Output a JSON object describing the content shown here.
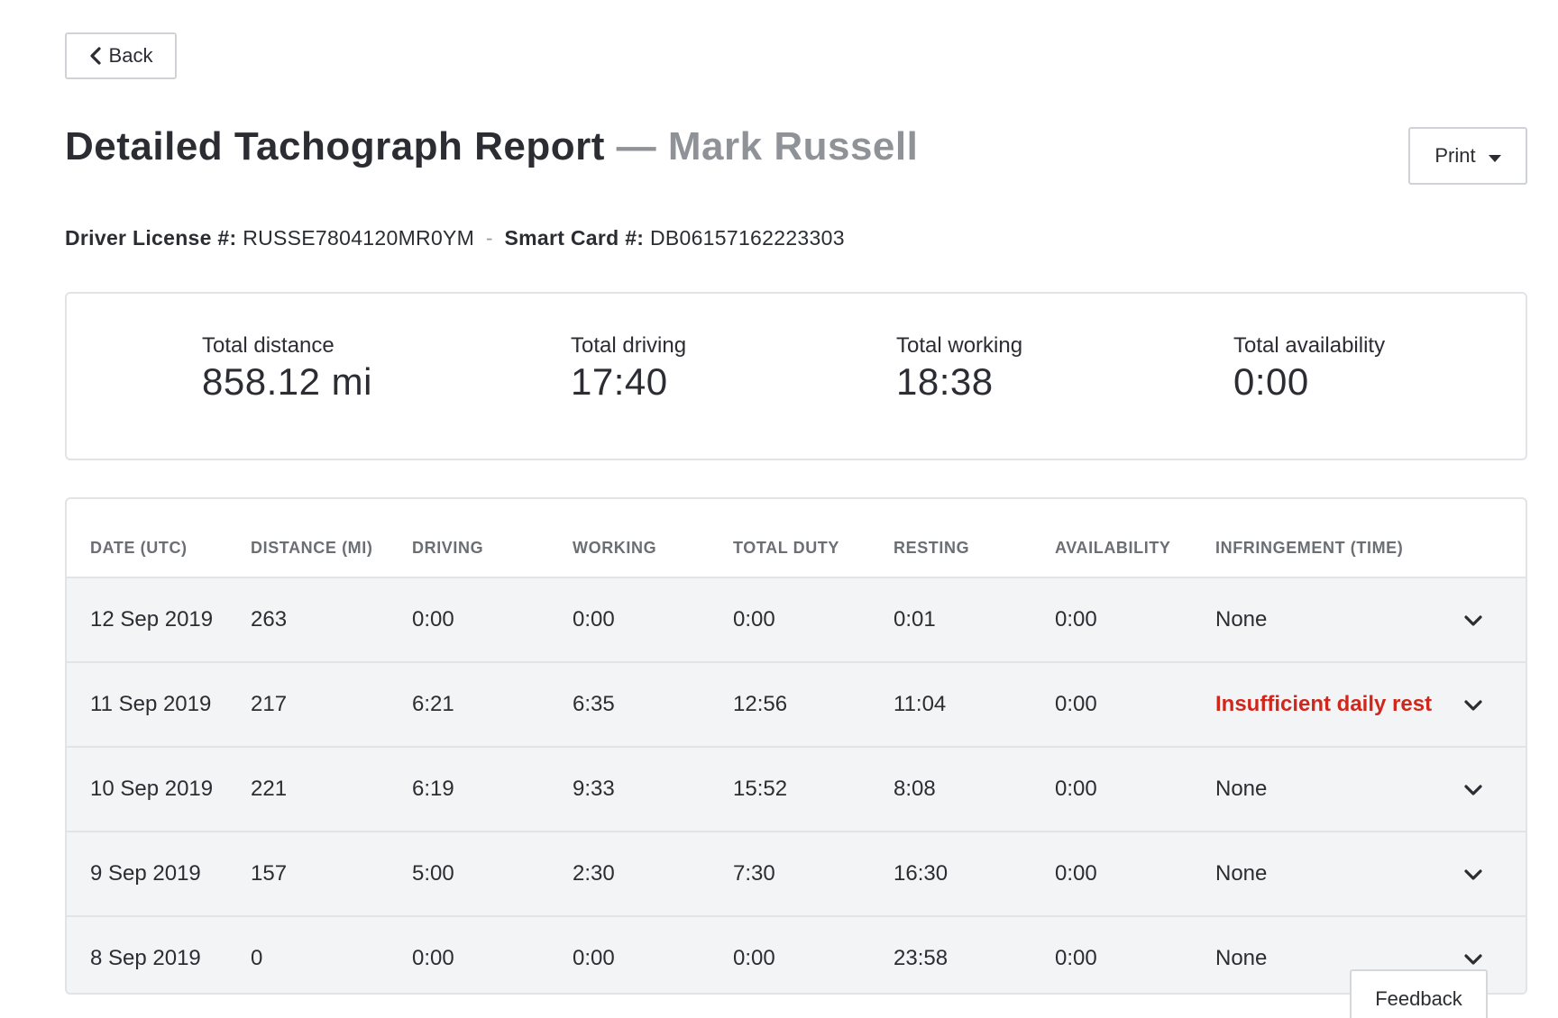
{
  "header": {
    "back_label": "Back",
    "title": "Detailed Tachograph Report",
    "subtitle": "— Mark Russell",
    "print_label": "Print"
  },
  "driver": {
    "license_label": "Driver License #:",
    "license_value": "RUSSE7804120MR0YM",
    "separator": "-",
    "card_label": "Smart Card #:",
    "card_value": "DB06157162223303"
  },
  "summary": [
    {
      "label": "Total distance",
      "value": "858.12 mi"
    },
    {
      "label": "Total driving",
      "value": "17:40"
    },
    {
      "label": "Total working",
      "value": "18:38"
    },
    {
      "label": "Total availability",
      "value": "0:00"
    }
  ],
  "table": {
    "columns": [
      "DATE (UTC)",
      "DISTANCE (MI)",
      "DRIVING",
      "WORKING",
      "TOTAL DUTY",
      "RESTING",
      "AVAILABILITY",
      "INFRINGEMENT (TIME)"
    ],
    "rows": [
      {
        "date": "12 Sep 2019",
        "distance": "263",
        "driving": "0:00",
        "working": "0:00",
        "total_duty": "0:00",
        "resting": "0:01",
        "availability": "0:00",
        "infringement": "None"
      },
      {
        "date": "11 Sep 2019",
        "distance": "217",
        "driving": "6:21",
        "working": "6:35",
        "total_duty": "12:56",
        "resting": "11:04",
        "availability": "0:00",
        "infringement": "Insufficient daily rest"
      },
      {
        "date": "10 Sep 2019",
        "distance": "221",
        "driving": "6:19",
        "working": "9:33",
        "total_duty": "15:52",
        "resting": "8:08",
        "availability": "0:00",
        "infringement": "None"
      },
      {
        "date": "9 Sep 2019",
        "distance": "157",
        "driving": "5:00",
        "working": "2:30",
        "total_duty": "7:30",
        "resting": "16:30",
        "availability": "0:00",
        "infringement": "None"
      },
      {
        "date": "8 Sep 2019",
        "distance": "0",
        "driving": "0:00",
        "working": "0:00",
        "total_duty": "0:00",
        "resting": "23:58",
        "availability": "0:00",
        "infringement": "None"
      }
    ]
  },
  "feedback_label": "Feedback",
  "colors": {
    "alert": "#d0271d",
    "row_background": "#f3f4f6",
    "border": "#e1e3e6",
    "muted_text": "#8f9297"
  },
  "icons": {
    "back": "chevron-left-icon",
    "print": "caret-down-icon",
    "row_expand": "chevron-down-icon"
  }
}
